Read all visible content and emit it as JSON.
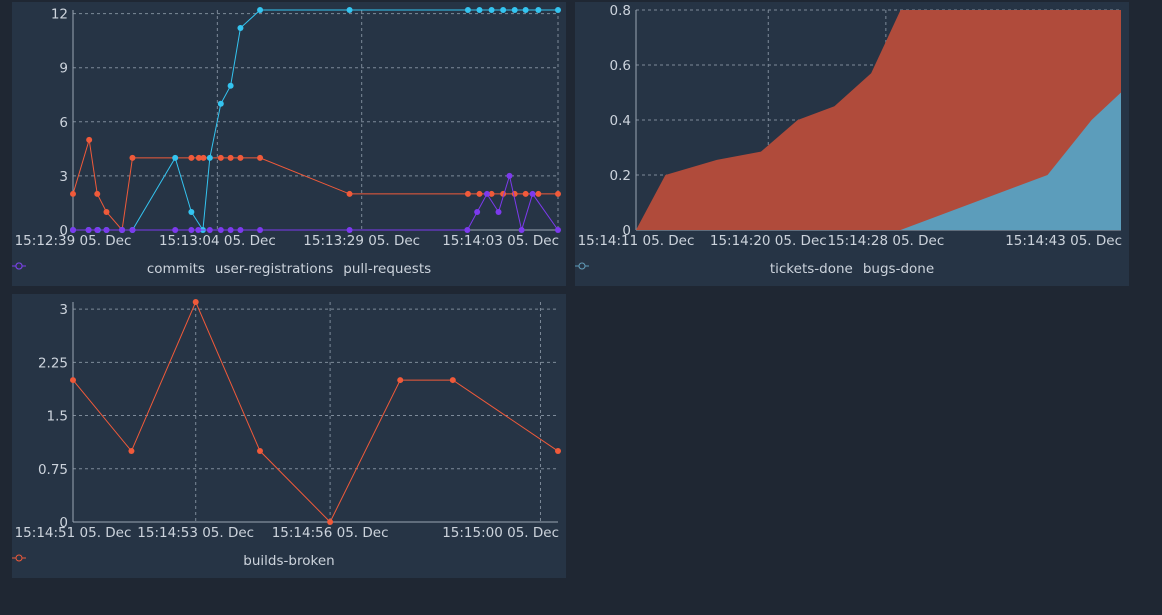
{
  "chart_data": [
    {
      "type": "line",
      "x_labels": [
        "15:12:39 05. Dec",
        "15:13:04 05. Dec",
        "15:13:29 05. Dec",
        "15:14:03 05. Dec"
      ],
      "x_label_times": [
        0,
        25,
        50,
        84
      ],
      "xlim": [
        0,
        84
      ],
      "ylim": [
        0,
        12.2
      ],
      "y_ticks": [
        "0",
        "3",
        "6",
        "9",
        "12"
      ],
      "y_tick_values": [
        0,
        3,
        6,
        9,
        12
      ],
      "grid": true,
      "legend": "bottom-center",
      "series": [
        {
          "name": "commits",
          "color": "#f05a3a",
          "points": [
            [
              0,
              2
            ],
            [
              2.8,
              5
            ],
            [
              4.2,
              2
            ],
            [
              5.8,
              1
            ],
            [
              8.5,
              0
            ],
            [
              10.3,
              4
            ],
            [
              20.5,
              4
            ],
            [
              21.8,
              4
            ],
            [
              22.6,
              4
            ],
            [
              25.6,
              4
            ],
            [
              27.3,
              4
            ],
            [
              29,
              4
            ],
            [
              32.4,
              4
            ],
            [
              47.9,
              2
            ],
            [
              68.4,
              2
            ],
            [
              70.4,
              2
            ],
            [
              72.5,
              2
            ],
            [
              74.5,
              2
            ],
            [
              76.5,
              2
            ],
            [
              78.4,
              2
            ],
            [
              80.6,
              2
            ],
            [
              84,
              2
            ]
          ]
        },
        {
          "name": "user-registrations",
          "color": "#34c4f0",
          "points": [
            [
              0,
              0
            ],
            [
              2.7,
              0
            ],
            [
              4.3,
              0
            ],
            [
              5.8,
              0
            ],
            [
              8.5,
              0
            ],
            [
              10.3,
              0
            ],
            [
              17.7,
              4
            ],
            [
              20.5,
              1
            ],
            [
              22.5,
              0
            ],
            [
              23.7,
              4
            ],
            [
              25.6,
              7
            ],
            [
              27.3,
              8
            ],
            [
              29,
              11.2
            ],
            [
              32.4,
              12.2
            ],
            [
              47.9,
              12.2
            ],
            [
              68.4,
              12.2
            ],
            [
              70.4,
              12.2
            ],
            [
              72.5,
              12.2
            ],
            [
              74.5,
              12.2
            ],
            [
              76.5,
              12.2
            ],
            [
              78.4,
              12.2
            ],
            [
              80.6,
              12.2
            ],
            [
              84,
              12.2
            ]
          ]
        },
        {
          "name": "pull-requests",
          "color": "#7c3aed",
          "points": [
            [
              0,
              0
            ],
            [
              2.7,
              0
            ],
            [
              4.2,
              0
            ],
            [
              5.8,
              0
            ],
            [
              8.5,
              0
            ],
            [
              10.3,
              0
            ],
            [
              17.7,
              0
            ],
            [
              20.5,
              0
            ],
            [
              21.7,
              0
            ],
            [
              23.7,
              0
            ],
            [
              25.6,
              0
            ],
            [
              27.3,
              0
            ],
            [
              29,
              0
            ],
            [
              32.4,
              0
            ],
            [
              47.9,
              0
            ],
            [
              68.3,
              0
            ],
            [
              70,
              1
            ],
            [
              71.7,
              2
            ],
            [
              73.7,
              1
            ],
            [
              75.6,
              3
            ],
            [
              77.7,
              0
            ],
            [
              79.6,
              2
            ],
            [
              84,
              0
            ]
          ]
        }
      ]
    },
    {
      "type": "area",
      "x_labels": [
        "15:14:11 05. Dec",
        "15:14:20 05. Dec",
        "15:14:28 05. Dec",
        "15:14:43 05. Dec"
      ],
      "x_label_times": [
        0,
        9,
        17,
        32
      ],
      "xlim": [
        0,
        33
      ],
      "ylim": [
        0,
        0.8
      ],
      "y_ticks": [
        "0",
        "0.2",
        "0.4",
        "0.6",
        "0.8"
      ],
      "y_tick_values": [
        0,
        0.2,
        0.4,
        0.6,
        0.8
      ],
      "grid": true,
      "legend": "bottom-center",
      "series": [
        {
          "name": "tickets-done",
          "color": "#b04b3b",
          "points": [
            [
              0,
              0
            ],
            [
              2,
              0.2
            ],
            [
              5.5,
              0.255
            ],
            [
              8.5,
              0.285
            ],
            [
              11,
              0.4
            ],
            [
              13.5,
              0.45
            ],
            [
              16,
              0.57
            ],
            [
              18,
              0.8
            ],
            [
              33,
              0.8
            ]
          ]
        },
        {
          "name": "bugs-done",
          "color": "#5c9dbb",
          "points": [
            [
              0,
              0
            ],
            [
              18,
              0
            ],
            [
              28,
              0.2
            ],
            [
              31,
              0.4
            ],
            [
              33,
              0.5
            ]
          ]
        }
      ]
    },
    {
      "type": "line",
      "x_labels": [
        "15:14:51 05. Dec",
        "15:14:53 05. Dec",
        "15:14:56 05. Dec",
        "15:15:00 05. Dec"
      ],
      "x_label_times": [
        0,
        2.1,
        4.4,
        8
      ],
      "xlim": [
        0,
        8.3
      ],
      "ylim": [
        0,
        3.1
      ],
      "y_ticks": [
        "0",
        "0.75",
        "1.5",
        "2.25",
        "3"
      ],
      "y_tick_values": [
        0,
        0.75,
        1.5,
        2.25,
        3
      ],
      "grid": true,
      "legend": "bottom-center",
      "series": [
        {
          "name": "builds-broken",
          "color": "#f05a3a",
          "points": [
            [
              0,
              2
            ],
            [
              1,
              1
            ],
            [
              2.1,
              3.1
            ],
            [
              3.2,
              1
            ],
            [
              4.4,
              0
            ],
            [
              5.6,
              2
            ],
            [
              6.5,
              2
            ],
            [
              8.3,
              1
            ]
          ]
        }
      ]
    }
  ]
}
